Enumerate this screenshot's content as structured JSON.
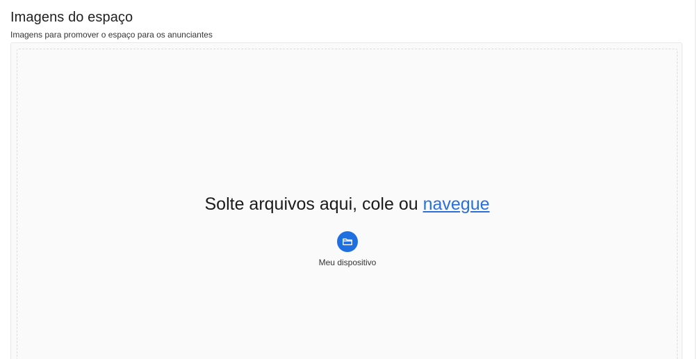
{
  "section": {
    "title": "Imagens do espaço",
    "subtitle": "Imagens para promover o espaço para os anunciantes"
  },
  "uploader": {
    "drop_text": "Solte arquivos aqui, cole ou ",
    "browse_link": "navegue",
    "sources": [
      {
        "label": "Meu dispositivo",
        "icon": "folder-icon",
        "color": "#1f6fe0"
      }
    ]
  },
  "colors": {
    "accent": "#1f6fe0",
    "link": "#2a6fdb",
    "dropzone_bg": "#fafafa"
  }
}
